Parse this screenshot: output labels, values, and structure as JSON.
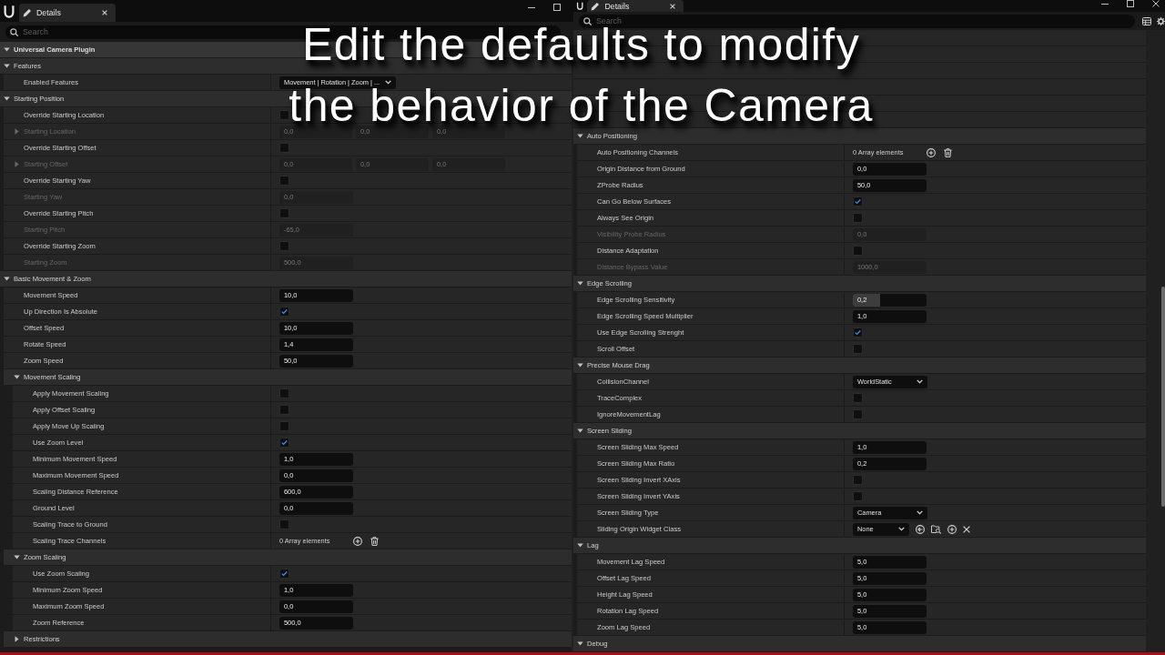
{
  "panels": [
    {
      "tab": {
        "label": "Details",
        "selected": true
      },
      "window_controls": [
        {
          "kind": "minimize"
        },
        {
          "kind": "maximize"
        }
      ],
      "search": {
        "placeholder": "Search"
      },
      "rows": [
        {
          "kind": "header",
          "label": "Universal Camera Plugin",
          "expanded": true
        },
        {
          "kind": "category",
          "label": "Features",
          "expanded": true,
          "children": [
            {
              "kind": "dropdown",
              "label": "Enabled Features",
              "value": "Movement | Rotation | Zoom | ...",
              "disabled": false
            }
          ]
        },
        {
          "kind": "category",
          "label": "Starting Position",
          "expanded": true,
          "children": [
            {
              "kind": "checkbox",
              "label": "Override Starting Location",
              "checked": false,
              "disabled": false
            },
            {
              "kind": "vector",
              "label": "Starting Location",
              "values": [
                "0,0",
                "0,0",
                "0,0"
              ],
              "expanded": false,
              "disabled": true
            },
            {
              "kind": "checkbox",
              "label": "Override Starting Offset",
              "checked": false,
              "disabled": false
            },
            {
              "kind": "vector",
              "label": "Starting Offset",
              "values": [
                "0,0",
                "0,0",
                "0,0"
              ],
              "expanded": false,
              "disabled": true
            },
            {
              "kind": "checkbox",
              "label": "Override Starting Yaw",
              "checked": false,
              "disabled": false
            },
            {
              "kind": "number",
              "label": "Starting Yaw",
              "value": "0,0",
              "disabled": true
            },
            {
              "kind": "checkbox",
              "label": "Override Starting Pitch",
              "checked": false,
              "disabled": false
            },
            {
              "kind": "number",
              "label": "Starting Pitch",
              "value": "-65,0",
              "disabled": true
            },
            {
              "kind": "checkbox",
              "label": "Override Starting Zoom",
              "checked": false,
              "disabled": false
            },
            {
              "kind": "number",
              "label": "Starting Zoom",
              "value": "500,0",
              "disabled": true
            }
          ]
        },
        {
          "kind": "category",
          "label": "Basic Movement & Zoom",
          "expanded": true,
          "children": [
            {
              "kind": "number",
              "label": "Movement Speed",
              "value": "10,0",
              "disabled": false
            },
            {
              "kind": "checkbox",
              "label": "Up Direction Is Absolute",
              "checked": true,
              "disabled": false
            },
            {
              "kind": "number",
              "label": "Offset Speed",
              "value": "10,0",
              "disabled": false
            },
            {
              "kind": "number",
              "label": "Rotate Speed",
              "value": "1,4",
              "disabled": false
            },
            {
              "kind": "number",
              "label": "Zoom Speed",
              "value": "50,0",
              "disabled": false
            },
            {
              "kind": "category",
              "label": "Movement Scaling",
              "expanded": true,
              "children": [
                {
                  "kind": "checkbox",
                  "label": "Apply Movement Scaling",
                  "checked": false,
                  "disabled": false
                },
                {
                  "kind": "checkbox",
                  "label": "Apply Offset Scaling",
                  "checked": false,
                  "disabled": false
                },
                {
                  "kind": "checkbox",
                  "label": "Apply Move Up Scaling",
                  "checked": false,
                  "disabled": false
                },
                {
                  "kind": "checkbox",
                  "label": "Use Zoom Level",
                  "checked": true,
                  "disabled": false
                },
                {
                  "kind": "number",
                  "label": "Minimum Movement Speed",
                  "value": "1,0",
                  "disabled": false
                },
                {
                  "kind": "number",
                  "label": "Maximum Movement Speed",
                  "value": "0,0",
                  "disabled": false
                },
                {
                  "kind": "number",
                  "label": "Scaling Distance Reference",
                  "value": "600,0",
                  "disabled": false
                },
                {
                  "kind": "number",
                  "label": "Ground Level",
                  "value": "0,0",
                  "disabled": false
                },
                {
                  "kind": "checkbox",
                  "label": "Scaling Trace to Ground",
                  "checked": false,
                  "disabled": false
                },
                {
                  "kind": "array",
                  "label": "Scaling Trace Channels",
                  "value": "0 Array elements",
                  "disabled": false
                }
              ]
            },
            {
              "kind": "category",
              "label": "Zoom Scaling",
              "expanded": true,
              "children": [
                {
                  "kind": "checkbox",
                  "label": "Use Zoom Scaling",
                  "checked": true,
                  "disabled": false
                },
                {
                  "kind": "number",
                  "label": "Minimum Zoom Speed",
                  "value": "1,0",
                  "disabled": false
                },
                {
                  "kind": "number",
                  "label": "Maximum Zoom Speed",
                  "value": "0,0",
                  "disabled": false
                },
                {
                  "kind": "number",
                  "label": "Zoom Reference",
                  "value": "500,0",
                  "disabled": false
                }
              ]
            },
            {
              "kind": "category",
              "label": "Restrictions",
              "expanded": false
            }
          ]
        }
      ]
    },
    {
      "tab": {
        "label": "Details",
        "selected": true
      },
      "window_controls": [
        {
          "kind": "minimize"
        },
        {
          "kind": "maximize"
        },
        {
          "kind": "close"
        }
      ],
      "search": {
        "placeholder": "Search"
      },
      "toolbar": [
        {
          "kind": "table"
        },
        {
          "kind": "settings"
        }
      ],
      "rows": [
        {
          "kind": "category",
          "label": "Auto Positioning",
          "expanded": true,
          "children": [
            {
              "kind": "array",
              "label": "Auto Positioning Channels",
              "value": "0 Array elements",
              "disabled": false
            },
            {
              "kind": "number",
              "label": "Origin Distance from Ground",
              "value": "0,0",
              "disabled": false
            },
            {
              "kind": "number",
              "label": "ZProbe Radius",
              "value": "50,0",
              "disabled": false
            },
            {
              "kind": "checkbox",
              "label": "Can Go Below Surfaces",
              "checked": true,
              "disabled": false
            },
            {
              "kind": "checkbox",
              "label": "Always See Origin",
              "checked": false,
              "disabled": false
            },
            {
              "kind": "number",
              "label": "Visibility Probe Radius",
              "value": "0,0",
              "disabled": true
            },
            {
              "kind": "checkbox",
              "label": "Distance Adaptation",
              "checked": false,
              "disabled": false
            },
            {
              "kind": "number",
              "label": "Distance Bypass Value",
              "value": "1000,0",
              "disabled": true
            }
          ]
        },
        {
          "kind": "category",
          "label": "Edge Scrolling",
          "expanded": true,
          "children": [
            {
              "kind": "slider",
              "label": "Edge Scrolling Sensitivity",
              "value": "0,2",
              "level": 0.37,
              "disabled": false
            },
            {
              "kind": "number",
              "label": "Edge Scrolling Speed Multiplier",
              "value": "1,0",
              "disabled": false
            },
            {
              "kind": "checkbox",
              "label": "Use Edge Scrolling Strenght",
              "checked": true,
              "disabled": false
            },
            {
              "kind": "checkbox",
              "label": "Scroll Offset",
              "checked": false,
              "disabled": false
            }
          ]
        },
        {
          "kind": "category",
          "label": "Precise Mouse Drag",
          "expanded": true,
          "children": [
            {
              "kind": "dropdown",
              "label": "CollisionChannel",
              "value": "WorldStatic",
              "disabled": false
            },
            {
              "kind": "checkbox",
              "label": "TraceComplex",
              "checked": false,
              "disabled": false
            },
            {
              "kind": "checkbox",
              "label": "IgnoreMovementLag",
              "checked": false,
              "disabled": false
            }
          ]
        },
        {
          "kind": "category",
          "label": "Screen Sliding",
          "expanded": true,
          "children": [
            {
              "kind": "number",
              "label": "Screen Sliding Max Speed",
              "value": "1,0",
              "disabled": false
            },
            {
              "kind": "number",
              "label": "Screen Sliding Max Ratio",
              "value": "0,2",
              "disabled": false
            },
            {
              "kind": "checkbox",
              "label": "Screen Sliding Invert XAxis",
              "checked": false,
              "disabled": false
            },
            {
              "kind": "checkbox",
              "label": "Screen Sliding Invert YAxis",
              "checked": false,
              "disabled": false
            },
            {
              "kind": "dropdown",
              "label": "Screen Sliding Type",
              "value": "Camera",
              "disabled": false
            },
            {
              "kind": "class",
              "label": "Sliding Origin Widget Class",
              "value": "None",
              "disabled": false
            }
          ]
        },
        {
          "kind": "category",
          "label": "Lag",
          "expanded": true,
          "children": [
            {
              "kind": "number",
              "label": "Movement Lag Speed",
              "value": "5,0",
              "disabled": false
            },
            {
              "kind": "number",
              "label": "Offset Lag Speed",
              "value": "5,0",
              "disabled": false
            },
            {
              "kind": "number",
              "label": "Height Lag Speed",
              "value": "5,0",
              "disabled": false
            },
            {
              "kind": "number",
              "label": "Rotation Lag Speed",
              "value": "5,0",
              "disabled": false
            },
            {
              "kind": "number",
              "label": "Zoom Lag Speed",
              "value": "5,0",
              "disabled": false
            }
          ]
        },
        {
          "kind": "category",
          "label": "Debug",
          "expanded": true
        }
      ]
    }
  ],
  "caption": {
    "lines": [
      "Edit the defaults to modify",
      "the behavior of the Camera"
    ]
  }
}
